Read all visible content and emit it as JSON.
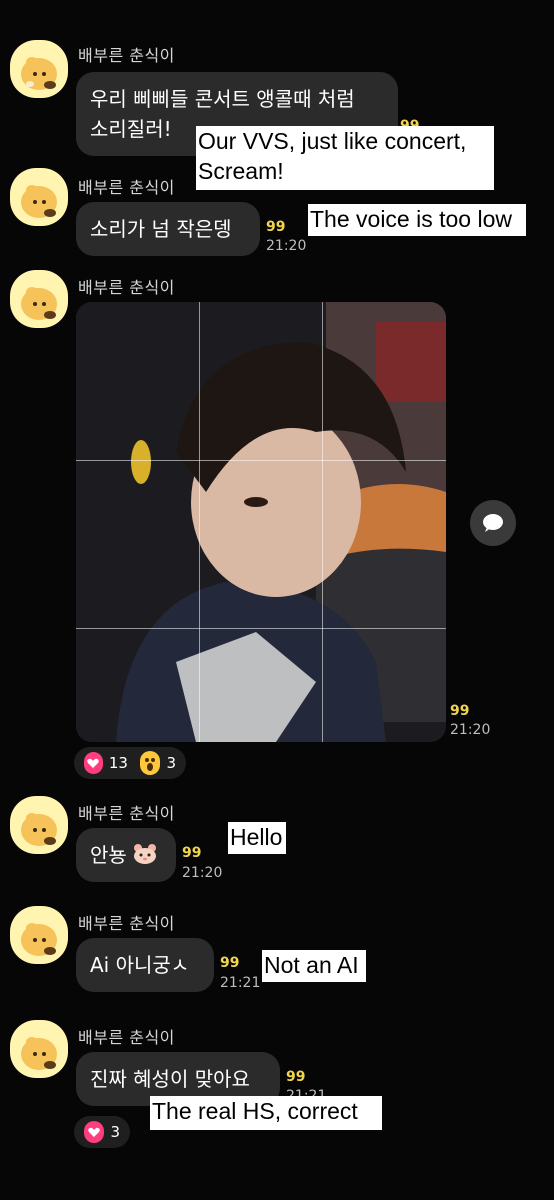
{
  "sender_name": "배부른 춘식이",
  "unread_badge": "99",
  "messages": [
    {
      "text_line1": "우리 삐삐들 콘서트 앵콜때 처럼",
      "text_line2": "소리질러!",
      "badge": "99",
      "overlay_line1": "Our VVS, just like concert,",
      "overlay_line2": "Scream!"
    },
    {
      "text": "소리가 넘 작은뎅",
      "badge": "99",
      "time": "21:20",
      "overlay": "The voice is too low"
    },
    {
      "type": "photo",
      "badge": "99",
      "time": "21:20",
      "reactions": [
        {
          "icon": "heart-icon",
          "count": "13"
        },
        {
          "icon": "surprised-face-icon",
          "count": "3"
        }
      ]
    },
    {
      "text": "안뇽",
      "badge": "99",
      "time": "21:20",
      "overlay": "Hello"
    },
    {
      "text": "Ai 아니궁ㅅ",
      "badge": "99",
      "time": "21:21",
      "overlay": "Not an AI"
    },
    {
      "text": "진짜 혜성이 맞아요",
      "badge": "99",
      "time": "21:21",
      "overlay": "The real HS, correct",
      "reactions": [
        {
          "icon": "heart-icon",
          "count": "3"
        }
      ]
    }
  ],
  "colors": {
    "background": "#060606",
    "bubble": "#2b2b2b",
    "badge": "#f2d54a",
    "heart": "#ff3d7f"
  }
}
